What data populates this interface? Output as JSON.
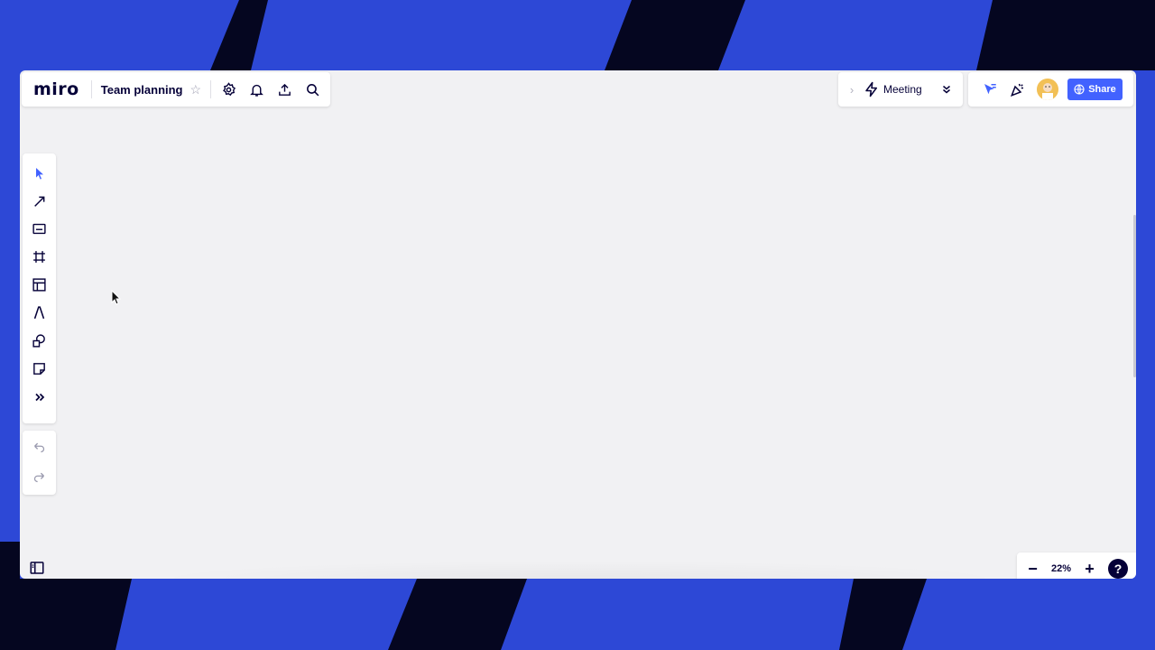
{
  "colors": {
    "background_blue": "#2d48d6",
    "stripe_dark": "#050620",
    "canvas": "#f1f1f3",
    "accent": "#4262ff",
    "text": "#050038"
  },
  "app": {
    "logo": "miro",
    "board_title": "Team planning"
  },
  "header": {
    "left_icons": [
      "star-icon",
      "settings-icon",
      "bell-icon",
      "upload-icon",
      "search-icon"
    ],
    "meeting_label": "Meeting",
    "share_label": "Share"
  },
  "toolbar": {
    "tools": [
      "select-icon",
      "pen-arrow-icon",
      "card-icon",
      "frame-icon",
      "template-icon",
      "text-icon",
      "shapes-icon",
      "sticky-note-icon",
      "more-icon"
    ],
    "undo": "undo-icon",
    "redo": "redo-icon"
  },
  "zoom": {
    "minus": "−",
    "value": "22%",
    "plus": "+",
    "help": "?"
  }
}
